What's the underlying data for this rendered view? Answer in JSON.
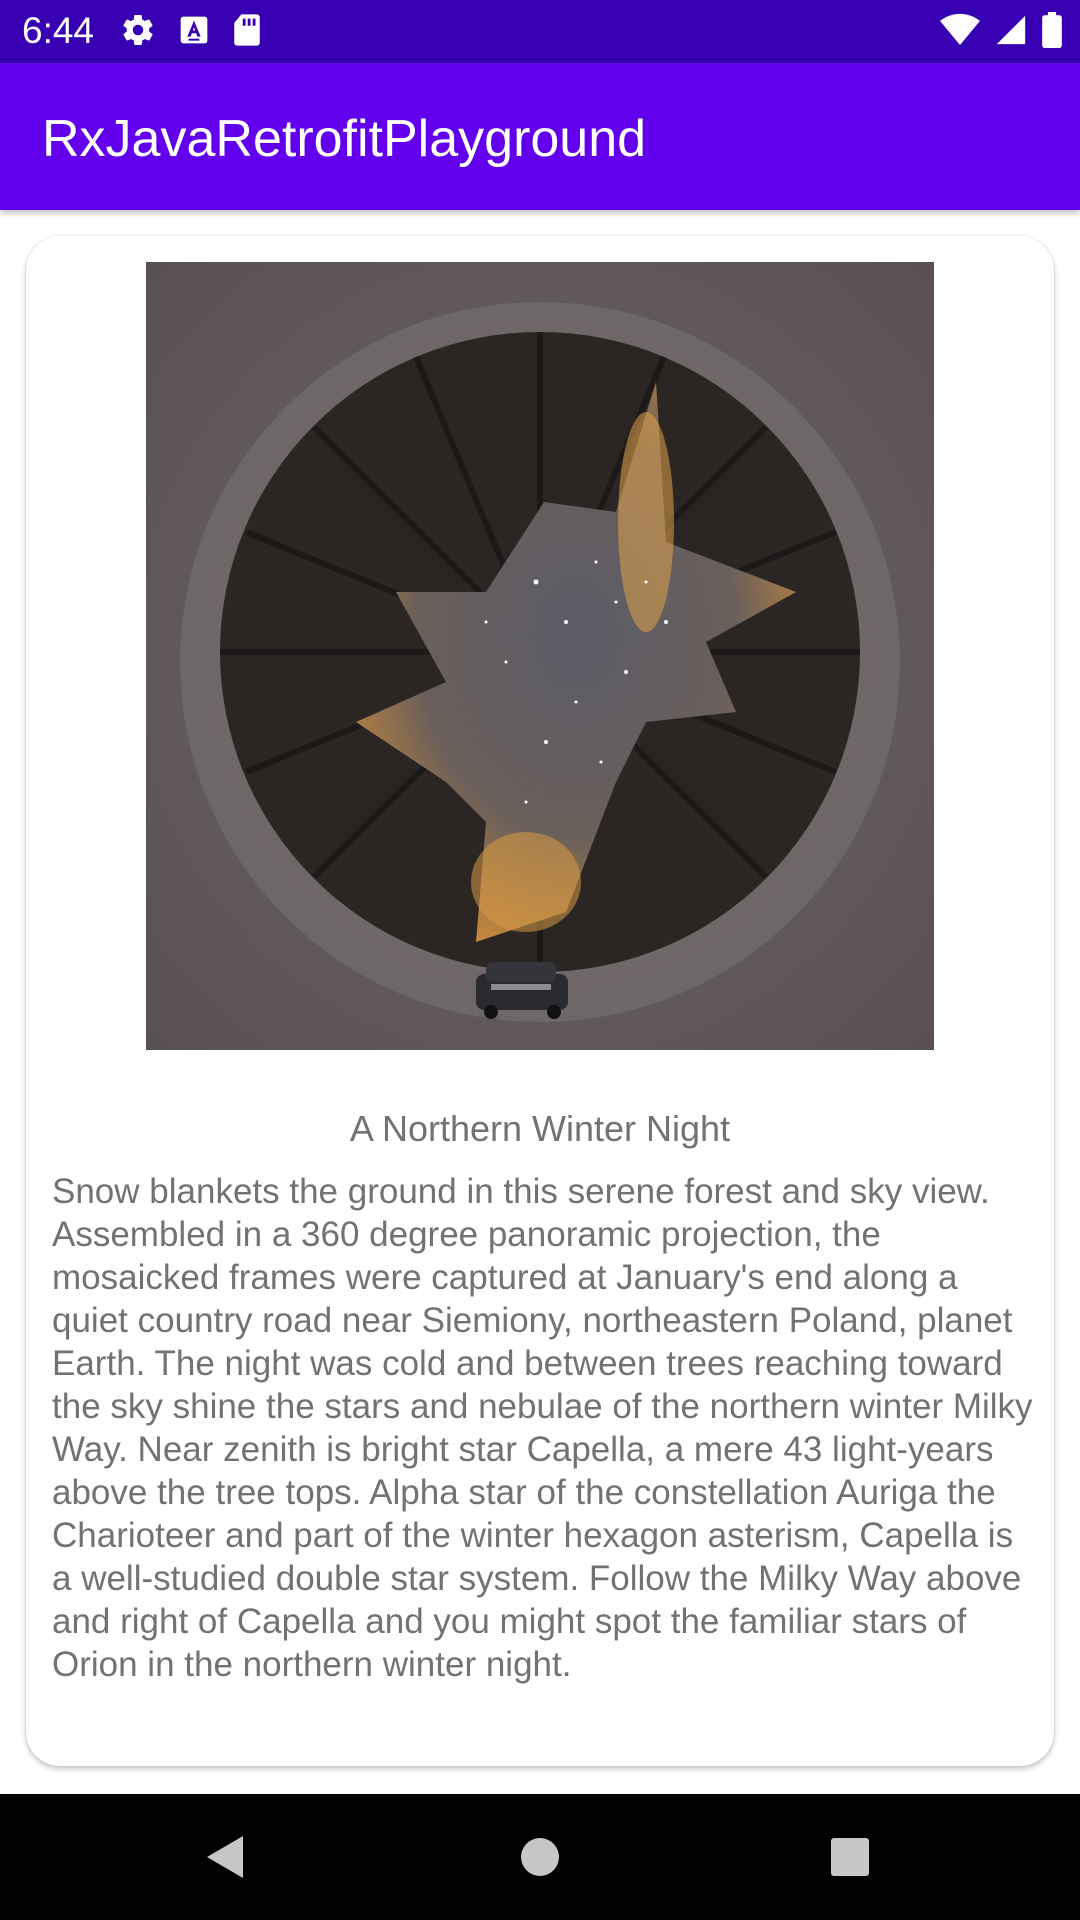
{
  "status_bar": {
    "time": "6:44",
    "left_icons": [
      "settings-icon",
      "text-a-icon",
      "sd-card-icon"
    ],
    "right_icons": [
      "wifi-icon",
      "cell-signal-icon",
      "battery-icon"
    ]
  },
  "app_bar": {
    "title": "RxJavaRetrofitPlayground"
  },
  "card": {
    "image_icon": "apod-photo",
    "title": "A Northern Winter Night",
    "description": "Snow blankets the ground in this serene forest and sky view. Assembled in a 360 degree panoramic projection, the mosaicked frames were captured at January's end along a quiet country road near Siemiony, northeastern Poland, planet Earth. The night was cold and between trees reaching toward the sky shine the stars and nebulae of the northern winter Milky Way. Near zenith is bright star Capella, a mere 43 light-years above the tree tops. Alpha star of the constellation Auriga the Charioteer and part of the winter hexagon asterism, Capella is a well-studied double star system. Follow the Milky Way above and right of Capella and you might spot the familiar stars of Orion in the northern winter night."
  },
  "nav_bar": {
    "icons": [
      "back-icon",
      "home-icon",
      "recents-icon"
    ]
  },
  "colors": {
    "status_bar": "#3700b3",
    "app_bar": "#6200ee",
    "text_secondary": "#727272"
  }
}
